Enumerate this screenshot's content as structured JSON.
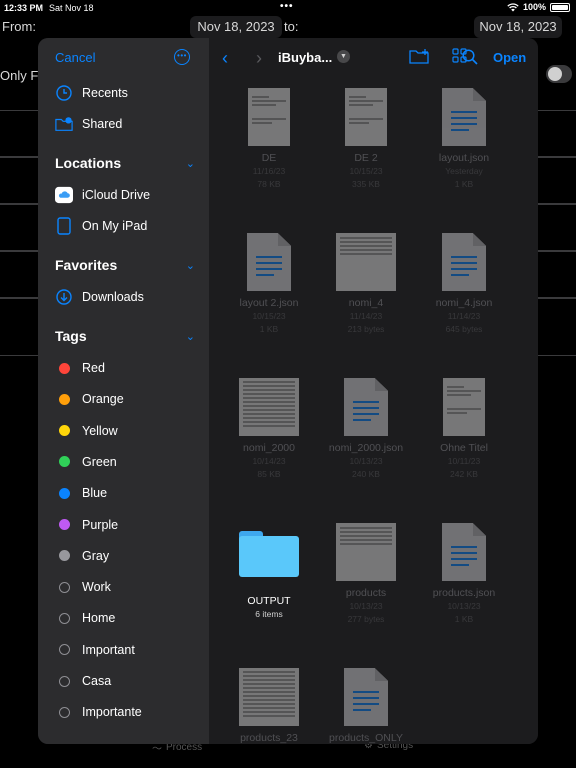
{
  "status_bar": {
    "time": "12:33 PM",
    "date": "Sat Nov 18",
    "battery": "100%"
  },
  "background": {
    "from_label": "From:",
    "to_label": "to:",
    "from_date": "Nov 18, 2023",
    "to_date": "Nov 18, 2023",
    "only_label": "Only Fr",
    "tab_process": "Process",
    "tab_settings": "Settings"
  },
  "sidebar": {
    "cancel_label": "Cancel",
    "recents_label": "Recents",
    "shared_label": "Shared",
    "locations_title": "Locations",
    "icloud_label": "iCloud Drive",
    "ipad_label": "On My iPad",
    "favorites_title": "Favorites",
    "downloads_label": "Downloads",
    "tags_title": "Tags",
    "tags": [
      {
        "label": "Red",
        "color": "#ff453a"
      },
      {
        "label": "Orange",
        "color": "#ff9f0a"
      },
      {
        "label": "Yellow",
        "color": "#ffd60a"
      },
      {
        "label": "Green",
        "color": "#30d158"
      },
      {
        "label": "Blue",
        "color": "#0a84ff"
      },
      {
        "label": "Purple",
        "color": "#bf5af2"
      },
      {
        "label": "Gray",
        "color": "#98989d"
      },
      {
        "label": "Work",
        "color": ""
      },
      {
        "label": "Home",
        "color": ""
      },
      {
        "label": "Important",
        "color": ""
      },
      {
        "label": "Casa",
        "color": ""
      },
      {
        "label": "Importante",
        "color": ""
      }
    ]
  },
  "toolbar": {
    "title": "iBuyba...",
    "open_label": "Open"
  },
  "files": [
    {
      "name": "DE",
      "date": "11/16/23",
      "size": "78 KB",
      "kind": "pdf"
    },
    {
      "name": "DE 2",
      "date": "10/15/23",
      "size": "335 KB",
      "kind": "pdf"
    },
    {
      "name": "layout.json",
      "date": "Yesterday",
      "size": "1 KB",
      "kind": "doc"
    },
    {
      "name": "layout 2.json",
      "date": "10/15/23",
      "size": "1 KB",
      "kind": "doc"
    },
    {
      "name": "nomi_4",
      "date": "11/14/23",
      "size": "213 bytes",
      "kind": "sheet"
    },
    {
      "name": "nomi_4.json",
      "date": "11/14/23",
      "size": "645 bytes",
      "kind": "doc"
    },
    {
      "name": "nomi_2000",
      "date": "10/14/23",
      "size": "85 KB",
      "kind": "list"
    },
    {
      "name": "nomi_2000.json",
      "date": "10/13/23",
      "size": "240 KB",
      "kind": "doc"
    },
    {
      "name": "Ohne Titel",
      "date": "10/11/23",
      "size": "242 KB",
      "kind": "pdf"
    },
    {
      "name": "OUTPUT",
      "date": "",
      "size": "6 items",
      "kind": "folder"
    },
    {
      "name": "products",
      "date": "10/13/23",
      "size": "277 bytes",
      "kind": "sheet"
    },
    {
      "name": "products.json",
      "date": "10/13/23",
      "size": "1 KB",
      "kind": "doc"
    },
    {
      "name": "products_23",
      "date": "",
      "size": "",
      "kind": "list"
    },
    {
      "name": "products_ONLY",
      "date": "",
      "size": "",
      "kind": "doc"
    }
  ]
}
